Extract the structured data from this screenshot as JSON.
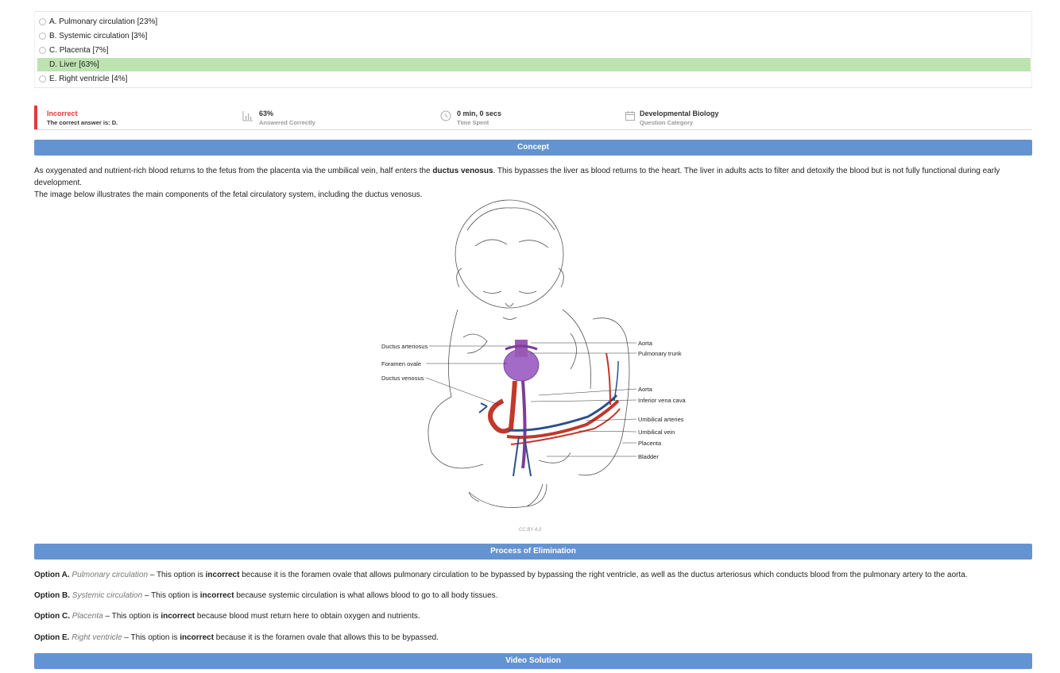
{
  "options": [
    {
      "label": "A. Pulmonary circulation [23%]",
      "correct": false
    },
    {
      "label": "B. Systemic circulation [3%]",
      "correct": false
    },
    {
      "label": "C. Placenta [7%]",
      "correct": false
    },
    {
      "label": "D. Liver [63%]",
      "correct": true
    },
    {
      "label": "E. Right ventricle [4%]",
      "correct": false
    }
  ],
  "stats": {
    "result_title": "Incorrect",
    "result_sub": "The correct answer is: D.",
    "percent": "63%",
    "percent_label": "Answered Correctly",
    "time": "0 min, 0 secs",
    "time_label": "Time Spent",
    "category": "Developmental Biology",
    "category_label": "Question Category"
  },
  "concept": {
    "header": "Concept",
    "text_1": "As oxygenated and nutrient-rich blood returns to the fetus from the placenta via the umbilical vein, half enters the ",
    "text_bold": "ductus venosus",
    "text_2": ". This bypasses the liver as blood returns to the heart. The liver in adults acts to filter and detoxify the blood but is not fully functional during early development.",
    "text_3": "The image below illustrates the main components of the fetal circulatory system, including the ductus venosus.",
    "figure_labels_left": [
      "Ductus arteriosus",
      "Foramen ovale",
      "Ductus venosus"
    ],
    "figure_labels_right": [
      "Aorta",
      "Pulmonary trunk",
      "Aorta",
      "Inferior vena cava",
      "Umbilical arteries",
      "Umbilical vein",
      "Placenta",
      "Bladder"
    ],
    "caption": "CC BY 4.0"
  },
  "elimination": {
    "header": "Process of Elimination",
    "items": [
      {
        "option": "Option A.",
        "name": "Pulmonary circulation",
        "pre": " – This option is ",
        "bold": "incorrect",
        "post": " because it is the foramen ovale that allows pulmonary circulation to be bypassed by bypassing the right ventricle, as well as the ductus arteriosus which conducts blood from the pulmonary artery to the aorta."
      },
      {
        "option": "Option B.",
        "name": "Systemic circulation",
        "pre": " – This option is ",
        "bold": "incorrect",
        "post": " because systemic circulation is what allows blood to go to all body tissues."
      },
      {
        "option": "Option C.",
        "name": "Placenta",
        "pre": " – This option is ",
        "bold": "incorrect",
        "post": " because blood must return here to obtain oxygen and nutrients."
      },
      {
        "option": "Option E.",
        "name": "Right ventricle",
        "pre": " – This option is ",
        "bold": "incorrect",
        "post": " because it is the foramen ovale that allows this to be bypassed."
      }
    ]
  },
  "video": {
    "header": "Video Solution"
  },
  "colors": {
    "accent": "#6493d1",
    "correct_bg": "#bde3b1",
    "incorrect": "#e53935"
  }
}
